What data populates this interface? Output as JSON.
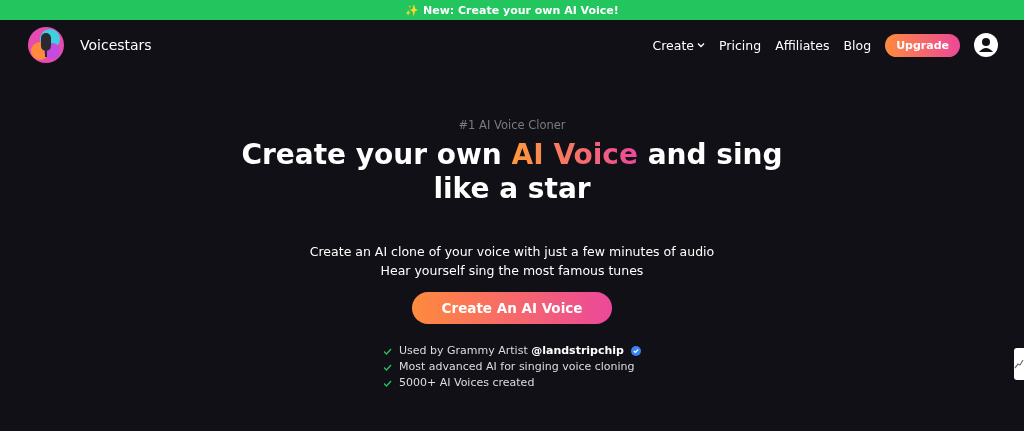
{
  "banner": {
    "icon": "✨",
    "text": "New: Create your own AI Voice!"
  },
  "nav": {
    "brand": "Voicestars",
    "links": [
      {
        "label": "Create",
        "dropdown": true
      },
      {
        "label": "Pricing",
        "dropdown": false
      },
      {
        "label": "Affiliates",
        "dropdown": false
      },
      {
        "label": "Blog",
        "dropdown": false
      }
    ],
    "upgrade": "Upgrade"
  },
  "hero": {
    "eyebrow": "#1 AI Voice Cloner",
    "headline": {
      "before": "Create your own ",
      "highlight": "AI Voice",
      "after": " and sing like a star"
    },
    "subtitle": [
      "Create an AI clone of your voice with just a few minutes of audio",
      "Hear yourself sing the most famous tunes"
    ],
    "cta": "Create An AI Voice",
    "features": [
      {
        "text": "Used by Grammy Artist **@landstripchip**",
        "verified": true
      },
      {
        "text": "Most advanced AI for singing voice cloning",
        "verified": false
      },
      {
        "text": "5000+ AI Voices created",
        "verified": false
      }
    ]
  }
}
